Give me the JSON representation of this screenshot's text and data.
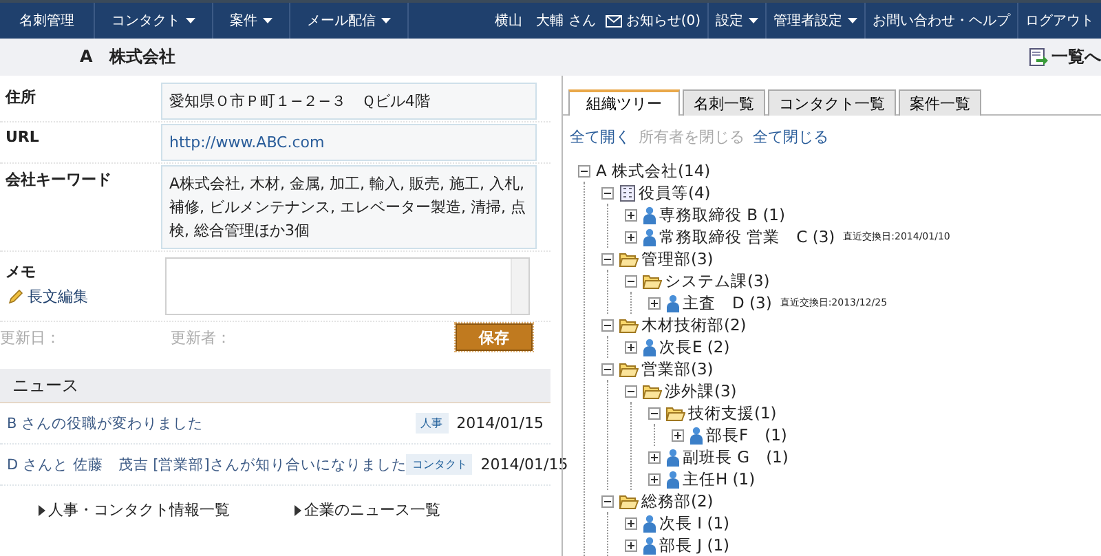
{
  "nav": {
    "left": [
      {
        "label": "名刺管理",
        "has_menu": false
      },
      {
        "label": "コンタクト",
        "has_menu": true
      },
      {
        "label": "案件",
        "has_menu": true
      },
      {
        "label": "メール配信",
        "has_menu": true
      }
    ],
    "user": "横山　大輔 さん",
    "notice": "お知らせ(0)",
    "right": [
      {
        "label": "設定",
        "has_menu": true
      },
      {
        "label": "管理者設定",
        "has_menu": true
      },
      {
        "label": "お問い合わせ・ヘルプ",
        "has_menu": false
      },
      {
        "label": "ログアウト",
        "has_menu": false
      }
    ]
  },
  "header": {
    "title": "A　株式会社",
    "list_link": "一覧へ"
  },
  "fields": [
    {
      "label": "住所",
      "kind": "text",
      "value": "愛知県Ｏ市Ｐ町１−２−３　Ｑビル4階"
    },
    {
      "label": "URL",
      "kind": "link",
      "value": "http://www.ABC.com"
    },
    {
      "label": "会社キーワード",
      "kind": "text",
      "value": "A株式会社, 木材, 金属, 加工, 輸入, 販売, 施工, 入札, 補修, ビルメンテナンス, エレベーター製造, 清掃, 点検, 総合管理ほか3個"
    }
  ],
  "memo": {
    "label": "メモ",
    "edit_link": "長文編集"
  },
  "updated_on": "更新日：",
  "updated_by": "更新者：",
  "save": "保存",
  "news": {
    "title": "ニュース",
    "items": [
      {
        "text": "B さんの役職が変わりました",
        "tag": "人事",
        "date": "2014/01/15"
      },
      {
        "text": "D さんと 佐藤　茂吉 [営業部]さんが知り合いになりました",
        "tag": "コンタクト",
        "date": "2014/01/15"
      }
    ],
    "links": [
      "人事・コンタクト情報一覧",
      "企業のニュース一覧"
    ]
  },
  "tabs": [
    {
      "label": "組織ツリー",
      "selected": true
    },
    {
      "label": "名刺一覧",
      "selected": false
    },
    {
      "label": "コンタクト一覧",
      "selected": false
    },
    {
      "label": "案件一覧",
      "selected": false
    }
  ],
  "tree_actions": [
    {
      "label": "全て開く",
      "disabled": false
    },
    {
      "label": "所有者を閉じる",
      "disabled": true
    },
    {
      "label": "全て閉じる",
      "disabled": false
    }
  ],
  "tree": [
    {
      "label": "A 株式会社(14)",
      "expanded": true,
      "children": [
        {
          "kind": "group",
          "label": "役員等(4)",
          "expanded": true,
          "children": [
            {
              "kind": "person",
              "label": "専務取締役 B (1)",
              "expanded": false
            },
            {
              "kind": "person",
              "label": "常務取締役 営業　C (3)",
              "note": "直近交換日:2014/01/10",
              "expanded": false
            }
          ]
        },
        {
          "kind": "department",
          "label": "管理部(3)",
          "expanded": true,
          "children": [
            {
              "kind": "department",
              "label": "システム課(3)",
              "expanded": true,
              "children": [
                {
                  "kind": "person",
                  "label": "主査　D (3)",
                  "note": "直近交換日:2013/12/25",
                  "expanded": false
                }
              ]
            }
          ]
        },
        {
          "kind": "department",
          "label": "木材技術部(2)",
          "expanded": true,
          "children": [
            {
              "kind": "person",
              "label": "次長E (2)",
              "expanded": false
            }
          ]
        },
        {
          "kind": "department",
          "label": "営業部(3)",
          "expanded": true,
          "children": [
            {
              "kind": "department",
              "label": "渉外課(3)",
              "expanded": true,
              "children": [
                {
                  "kind": "department",
                  "label": "技術支援(1)",
                  "expanded": true,
                  "children": [
                    {
                      "kind": "person",
                      "label": "部長F　(1)",
                      "expanded": false
                    }
                  ]
                },
                {
                  "kind": "person",
                  "label": "副班長 G　(1)",
                  "expanded": false
                },
                {
                  "kind": "person",
                  "label": "主任H (1)",
                  "expanded": false
                }
              ]
            }
          ]
        },
        {
          "kind": "department",
          "label": "総務部(2)",
          "expanded": true,
          "children": [
            {
              "kind": "person",
              "label": "次長 I (1)",
              "expanded": false
            },
            {
              "kind": "person",
              "label": "部長 J (1)",
              "expanded": false
            }
          ]
        }
      ]
    }
  ]
}
